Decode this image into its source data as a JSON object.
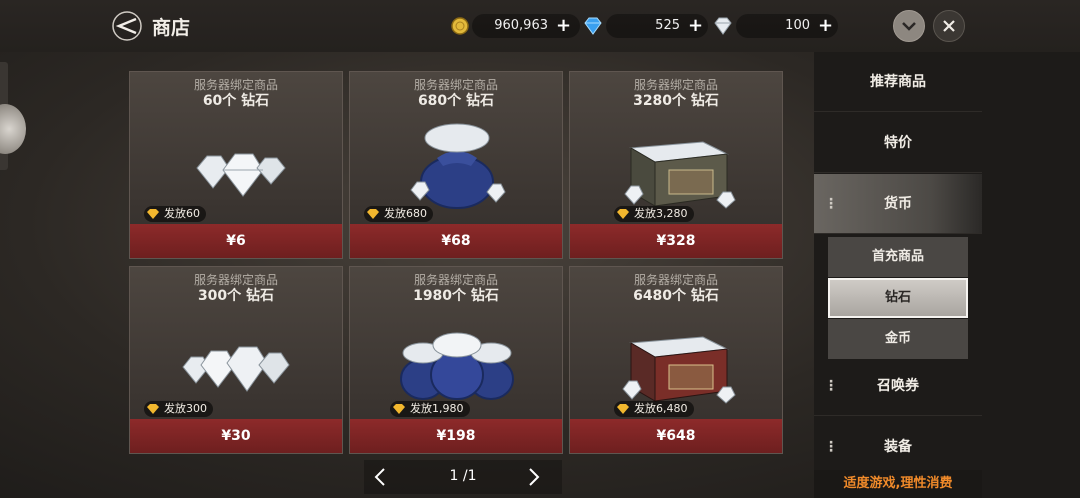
{
  "header": {
    "title": "商店",
    "gold": {
      "value": "960,963",
      "plus": "+"
    },
    "blue_diamond": {
      "value": "525",
      "plus": "+"
    },
    "white_diamond": {
      "value": "100",
      "plus": "+"
    }
  },
  "products": [
    {
      "subtitle": "服务器绑定商品",
      "name": "60个 钻石",
      "bonus": "发放60",
      "price": "¥6",
      "art": "diamond-pile-small"
    },
    {
      "subtitle": "服务器绑定商品",
      "name": "680个 钻石",
      "bonus": "发放680",
      "price": "¥68",
      "art": "diamond-bag"
    },
    {
      "subtitle": "服务器绑定商品",
      "name": "3280个 钻石",
      "bonus": "发放3,280",
      "price": "¥328",
      "art": "diamond-chest"
    },
    {
      "subtitle": "服务器绑定商品",
      "name": "300个 钻石",
      "bonus": "发放300",
      "price": "¥30",
      "art": "diamond-pile-large"
    },
    {
      "subtitle": "服务器绑定商品",
      "name": "1980个 钻石",
      "bonus": "发放1,980",
      "price": "¥198",
      "art": "diamond-bags"
    },
    {
      "subtitle": "服务器绑定商品",
      "name": "6480个 钻石",
      "bonus": "发放6,480",
      "price": "¥648",
      "art": "diamond-chest-red"
    }
  ],
  "pager": {
    "text": "1 /1"
  },
  "sidebar": {
    "categories": [
      "推荐商品",
      "特价",
      "货币",
      "召唤券",
      "装备"
    ],
    "subcategories": [
      "首充商品",
      "钻石",
      "金币"
    ],
    "notice": "适度游戏,理性消费"
  },
  "colors": {
    "price_bar": "#8d2a2a",
    "notice": "#f08a2a",
    "gold": "#e2b93b"
  }
}
